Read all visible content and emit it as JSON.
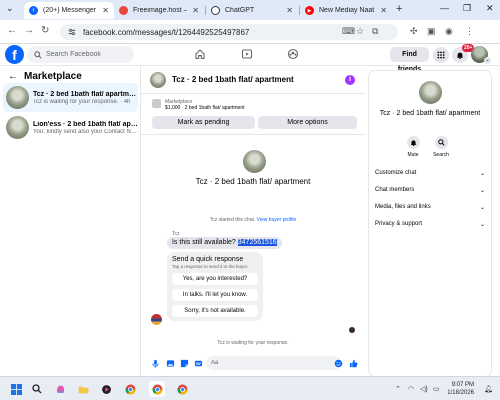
{
  "browser": {
    "tabs": [
      {
        "title": "(20+) Messenger | Faceb",
        "active": true
      },
      {
        "title": "Freeimage.host — Imag",
        "active": false
      },
      {
        "title": "ChatGPT",
        "active": false
      },
      {
        "title": "New Mediay Naat Naat",
        "active": false
      }
    ],
    "url": "facebook.com/messages/t/1264492525497867"
  },
  "fb_header": {
    "search_placeholder": "Search Facebook",
    "find_friends": "Find friends",
    "notif_badge": "20+"
  },
  "left_panel": {
    "title": "Marketplace",
    "conversations": [
      {
        "name": "Tcz · 2 bed 1bath flat/ apartment",
        "preview": "Tcz is waiting for your response. · 4h",
        "selected": true
      },
      {
        "name": "Lion'ess · 2 bed 1bath flat/ apartment",
        "preview": "You: kindly send also your Contact Nu... · 1d",
        "selected": false
      }
    ]
  },
  "chat": {
    "header_title": "Tcz · 2 bed 1bath flat/ apartment",
    "listing_label": "Marketplace",
    "listing_detail": "$1,000 · 2 bed 1bath flat/ apartment",
    "mark_pending": "Mark as pending",
    "more_options": "More options",
    "profile_name": "Tcz · 2 bed 1bath flat/ apartment",
    "started_text": "Tcz started this chat.",
    "view_profile": "View buyer profile",
    "sender_label": "Tcz",
    "message_text": "Is this still available? ",
    "message_phone": "3472561516",
    "quick_title": "Send a quick response",
    "quick_subtitle": "Tap a response to send it to the buyer.",
    "quick_replies": [
      "Yes, are you interested?",
      "In talks. I'll let you know.",
      "Sorry, it's not available."
    ],
    "waiting_text": "Tcz is waiting for your response.",
    "composer_placeholder": "Aa"
  },
  "right_panel": {
    "name": "Tcz · 2 bed 1bath flat/ apartment",
    "actions": [
      {
        "label": "Mute"
      },
      {
        "label": "Search"
      }
    ],
    "sections": [
      "Customize chat",
      "Chat members",
      "Media, files and links",
      "Privacy & support"
    ]
  },
  "taskbar": {
    "time": "9:07 PM",
    "date": "1/18/2026"
  },
  "colors": {
    "fb_blue": "#0866ff",
    "selected_bg": "#ebf5ff",
    "badge_red": "#e41e3f",
    "info_purple": "#a033ff"
  }
}
